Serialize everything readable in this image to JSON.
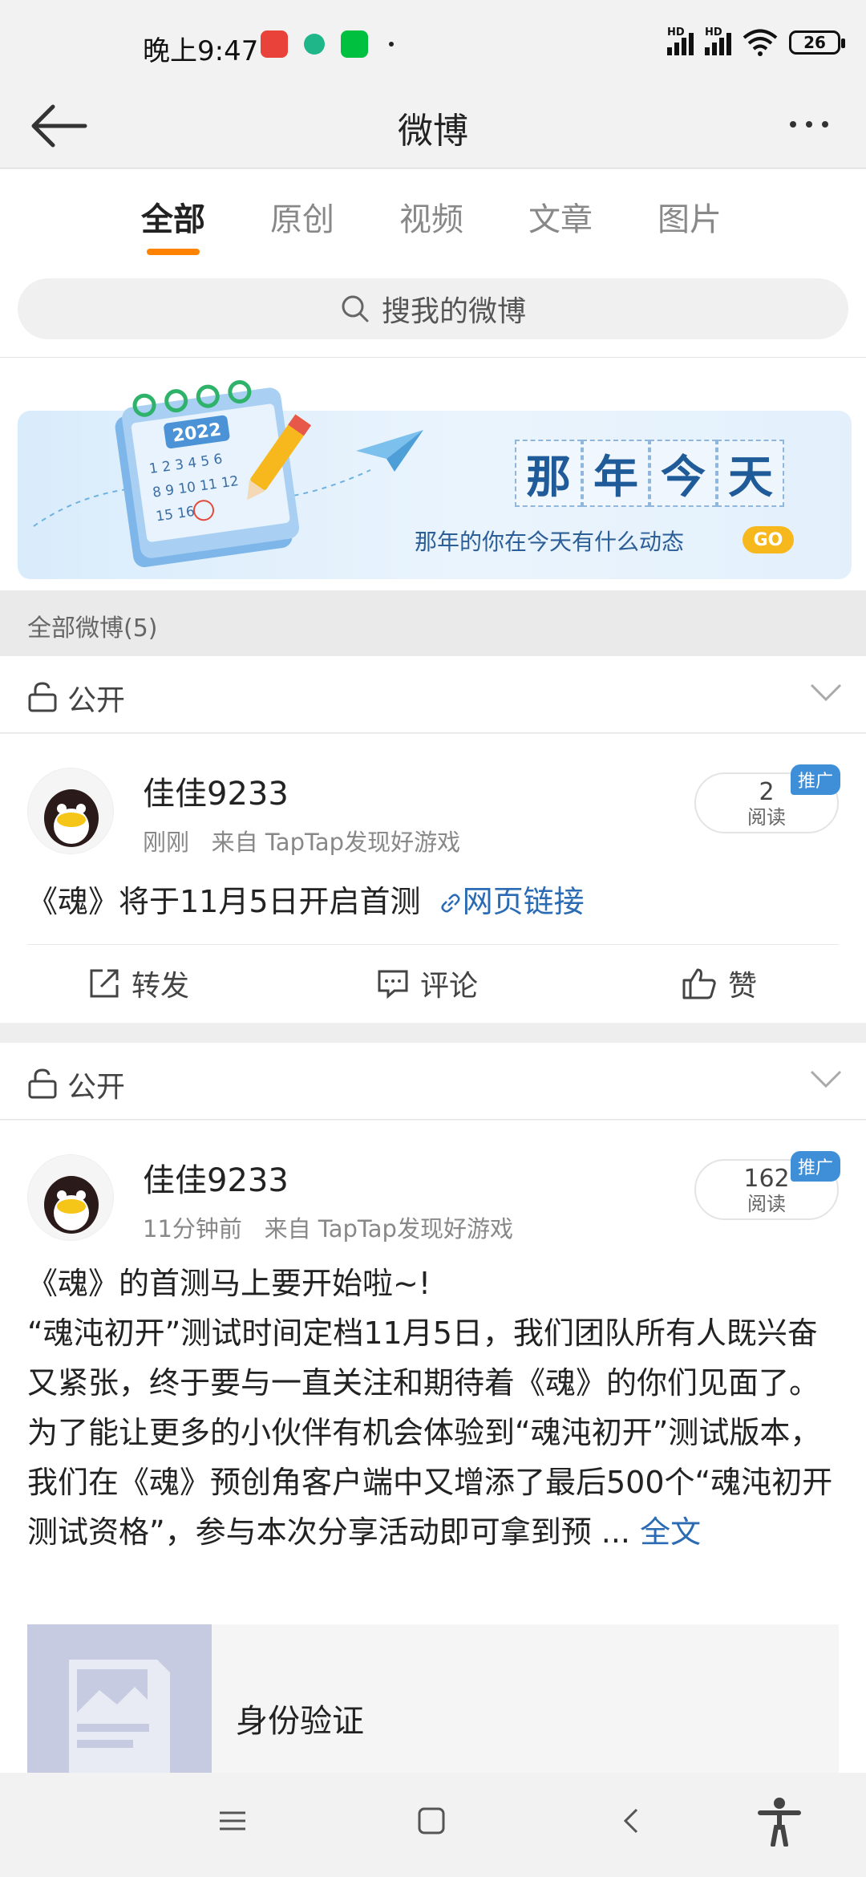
{
  "status_bar": {
    "time": "晚上9:47",
    "battery": "26",
    "app_icon_colors": [
      "#e8423a",
      "#1fb68a",
      "#00c03f"
    ]
  },
  "header": {
    "title": "微博"
  },
  "tabs": [
    "全部",
    "原创",
    "视频",
    "文章",
    "图片"
  ],
  "active_tab_index": 0,
  "search": {
    "placeholder": "搜我的微博"
  },
  "banner": {
    "year": "2022",
    "title_chars": [
      "那",
      "年",
      "今",
      "天"
    ],
    "subtitle": "那年的你在今天有什么动态",
    "go_label": "GO"
  },
  "section_label": "全部微博(5)",
  "posts": [
    {
      "privacy": "公开",
      "username": "佳佳9233",
      "time": "刚刚",
      "source": "来自 TapTap发现好游戏",
      "reads": "2",
      "reads_label": "阅读",
      "badge": "推广",
      "text": "《魂》将于11月5日开启首测",
      "link_text": "网页链接",
      "actions": {
        "repost": "转发",
        "comment": "评论",
        "like": "赞"
      }
    },
    {
      "privacy": "公开",
      "username": "佳佳9233",
      "time": "11分钟前",
      "source": "来自 TapTap发现好游戏",
      "reads": "162",
      "reads_label": "阅读",
      "badge": "推广",
      "text_lines": [
        "《魂》的首测马上要开始啦~!",
        "“魂沌初开”测试时间定档11月5日，我们团队所有人既兴奋又紧张，终于要与一直关注和期待着《魂》的你们见面了。",
        "为了能让更多的小伙伴有机会体验到“魂沌初开”测试版本，我们在《魂》预创角客户端中又增添了最后500个“魂沌初开测试资格”，参与本次分享活动即可拿到预 ..."
      ],
      "more_label": "全文",
      "card_title": "身份验证"
    }
  ],
  "colors": {
    "accent": "#ff8200",
    "link": "#2a6bb3",
    "badge": "#3f8fd8"
  }
}
